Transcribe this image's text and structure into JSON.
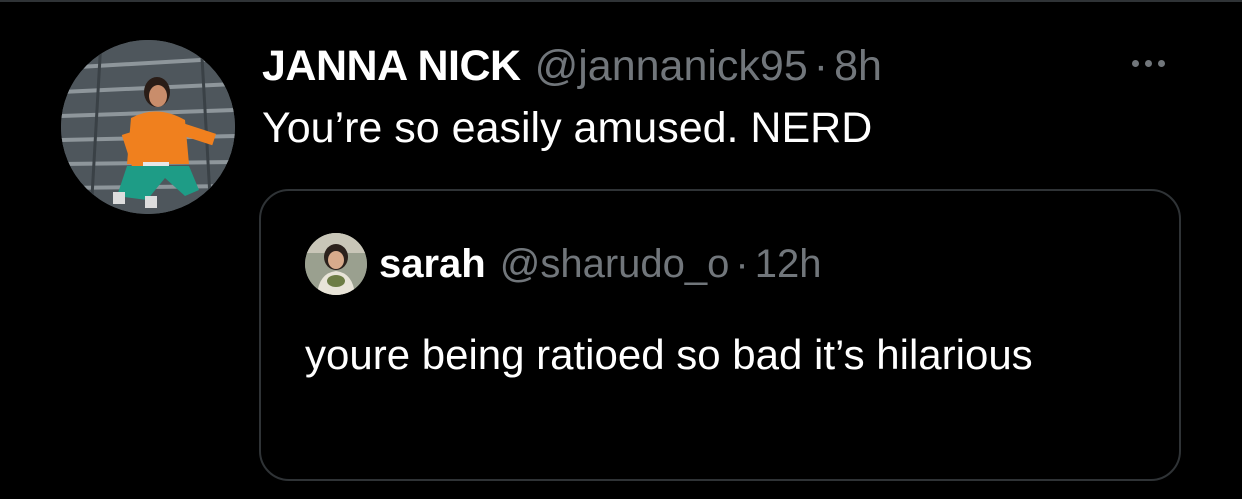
{
  "tweet": {
    "display_name": "JANNA NICK",
    "handle": "@jannanick95",
    "separator": "·",
    "timestamp": "8h",
    "text": "You’re so easily amused. NERD",
    "more_icon": "more-horizontal-icon"
  },
  "quoted_tweet": {
    "display_name": "sarah",
    "handle": "@sharudo_o",
    "separator": "·",
    "timestamp": "12h",
    "text": "youre being ratioed so bad it’s hilarious"
  },
  "colors": {
    "background": "#000000",
    "primary_text": "#ffffff",
    "secondary_text": "#71767b",
    "border": "#2f3336"
  }
}
